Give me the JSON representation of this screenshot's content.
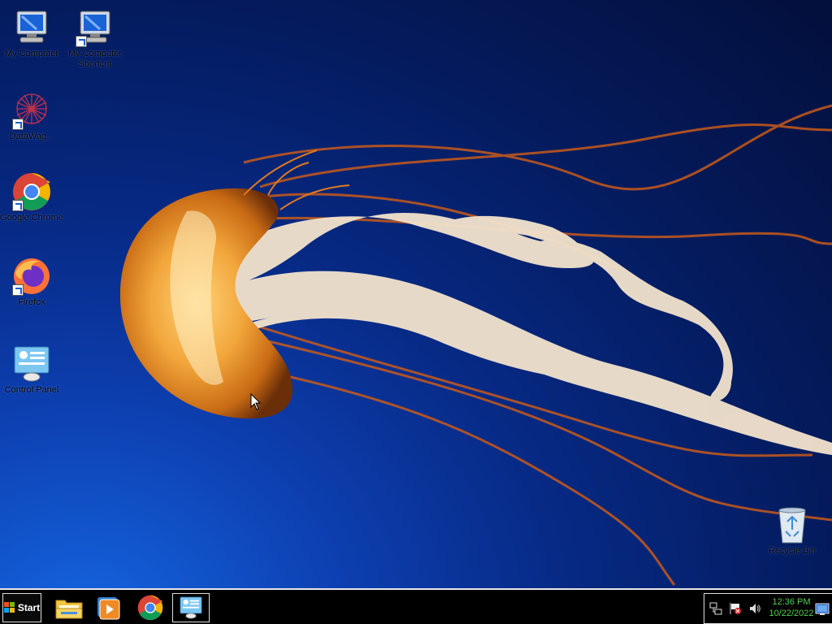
{
  "desktop": {
    "icons": [
      {
        "label": "My Computer"
      },
      {
        "label": "My Computer Shortcut"
      },
      {
        "label": "DataWag..."
      },
      {
        "label": "Google Chrome"
      },
      {
        "label": "Firefox"
      },
      {
        "label": "Control Panel"
      },
      {
        "label": "Recycle Bin"
      }
    ]
  },
  "taskbar": {
    "start_label": "Start",
    "apps": [
      "file-explorer",
      "media-player",
      "google-chrome",
      "control-panel"
    ],
    "clock": {
      "time": "12:36 PM",
      "date": "10/22/2022"
    }
  },
  "colors": {
    "clock_text": "#4ed34e",
    "taskbar_bg": "#000000"
  }
}
